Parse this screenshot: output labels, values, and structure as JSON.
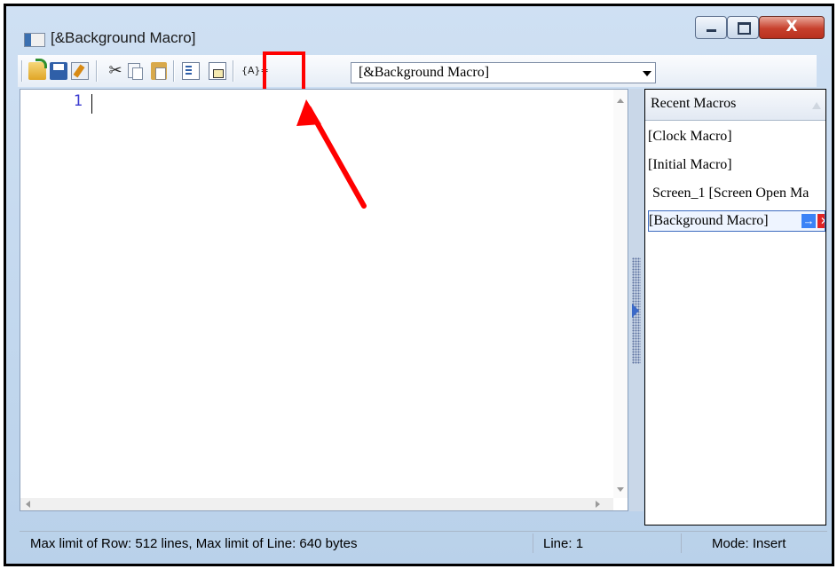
{
  "window": {
    "title": "[&Background Macro]",
    "close_label": "X"
  },
  "toolbar": {
    "cut_glyph": "✂",
    "variable_label": "{A}=",
    "macro_select_value": "[&Background Macro]"
  },
  "editor": {
    "line_number": "1",
    "content": ""
  },
  "recent": {
    "header": "Recent Macros",
    "items": [
      {
        "label": "[Clock Macro]"
      },
      {
        "label": "[Initial Macro]"
      },
      {
        "label": "Screen_1 [Screen Open Ma"
      },
      {
        "label": "[Background Macro]",
        "selected": true
      }
    ],
    "go_glyph": "→",
    "delete_glyph": "✕"
  },
  "status": {
    "limits": "Max limit of Row: 512 lines, Max limit of Line: 640 bytes",
    "line": "Line: 1",
    "mode": "Mode: Insert"
  },
  "colors": {
    "annotation": "#ff0000",
    "line_number": "#3b3bd0",
    "selection_border": "#3d6cc0"
  }
}
